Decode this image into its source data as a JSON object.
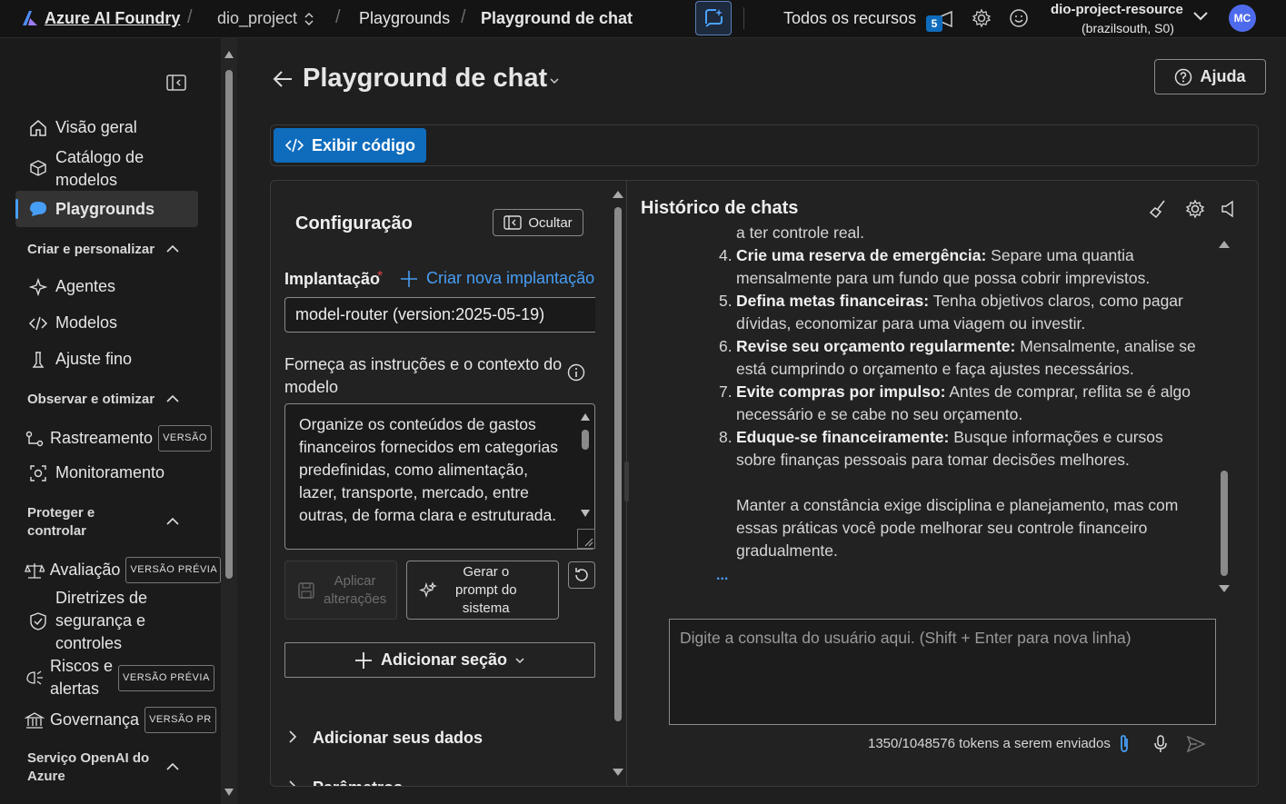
{
  "topbar": {
    "brand": "Azure AI Foundry",
    "project": "dio_project",
    "crumb_playgrounds": "Playgrounds",
    "crumb_current": "Playground de chat",
    "all_resources": "Todos os recursos",
    "notif_count": "5",
    "resource_name": "dio-project-resource",
    "resource_region": "(brazilsouth, S0)",
    "avatar": "MC"
  },
  "sidebar": {
    "items": [
      {
        "label": "Visão geral",
        "icon": "home-icon"
      },
      {
        "label1": "Catálogo de",
        "label2": "modelos",
        "icon": "cube-icon"
      },
      {
        "label": "Playgrounds",
        "icon": "chat-bubble-icon"
      }
    ],
    "section_create": "Criar e personalizar",
    "create_items": [
      "Agentes",
      "Modelos",
      "Ajuste fino"
    ],
    "section_observe": "Observar e otimizar",
    "observe_items": [
      "Rastreamento",
      "Monitoramento"
    ],
    "badge_versao": "VERSÃO",
    "section_protect1": "Proteger e",
    "section_protect2": "controlar",
    "protect": {
      "avaliacao": "Avaliação",
      "badge_previa": "VERSÃO PRÉVIA",
      "diretrizes1": "Diretrizes de",
      "diretrizes2": "segurança e",
      "diretrizes3": "controles",
      "riscos1": "Riscos e",
      "riscos2": "alertas",
      "governanca": "Governança",
      "badge_pr": "VERSÃO PR"
    },
    "section_openai1": "Serviço OpenAI do",
    "section_openai2": "Azure"
  },
  "page": {
    "title": "Playground de chat",
    "help": "Ajuda",
    "view_code": "Exibir código"
  },
  "config": {
    "title": "Configuração",
    "hide": "Ocultar",
    "deployment_label": "Implantação",
    "required": "*",
    "create_deployment": "Criar nova implantação",
    "deployment_value": "model-router (version:2025-05-19)",
    "instructions_label1": "Forneça as instruções e o contexto do",
    "instructions_label2": "modelo",
    "instructions_lines": [
      "Organize os conteúdos de gastos",
      "financeiros fornecidos em categorias",
      "predefinidas, como alimentação,",
      "lazer, transporte, mercado, entre",
      "outras, de forma clara e estruturada."
    ],
    "apply1": "Aplicar",
    "apply2": "alterações",
    "generate1": "Gerar o",
    "generate2": "prompt do",
    "generate3": "sistema",
    "add_section": "Adicionar seção",
    "add_data": "Adicionar seus dados",
    "params": "Parâmetros"
  },
  "chat": {
    "title": "Histórico de chats",
    "cut_line": "a ter controle real.",
    "items": [
      {
        "n": "4.",
        "bold": "Crie uma reserva de emergência:",
        "text": " Separe uma quantia",
        "cont": "mensalmente para um fundo que possa cobrir imprevistos."
      },
      {
        "n": "5.",
        "bold": "Defina metas financeiras:",
        "text": " Tenha objetivos claros, como pagar",
        "cont": "dívidas, economizar para uma viagem ou investir."
      },
      {
        "n": "6.",
        "bold": "Revise seu orçamento regularmente:",
        "text": " Mensalmente, analise se",
        "cont": "está cumprindo o orçamento e faça ajustes necessários."
      },
      {
        "n": "7.",
        "bold": "Evite compras por impulso:",
        "text": " Antes de comprar, reflita se é algo",
        "cont": "necessário e se cabe no seu orçamento."
      },
      {
        "n": "8.",
        "bold": "Eduque-se financeiramente:",
        "text": " Busque informações e cursos",
        "cont": "sobre finanças pessoais para tomar decisões melhores."
      }
    ],
    "closing": [
      "Manter a constância exige disciplina e planejamento, mas com",
      "essas práticas você pode melhorar seu controle financeiro",
      "gradualmente."
    ],
    "ellipsis": "...",
    "input_placeholder": "Digite a consulta do usuário aqui. (Shift + Enter para nova linha)",
    "tokens": "1350/1048576 tokens a serem enviados"
  },
  "colors": {
    "accent": "#0f6cbd",
    "link": "#479ef5",
    "required": "#e04646"
  }
}
